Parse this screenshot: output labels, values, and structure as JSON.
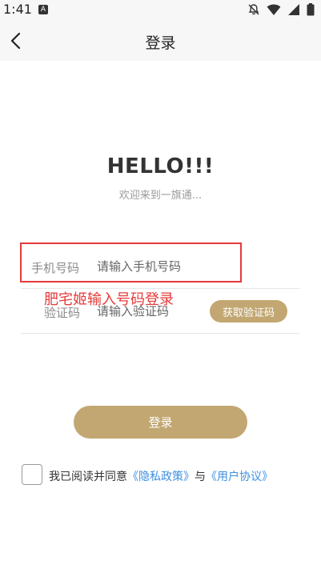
{
  "status_bar": {
    "time": "1:41",
    "notification_letter": "A"
  },
  "nav": {
    "title": "登录"
  },
  "greeting": {
    "title": "HELLO!!!",
    "subtitle": "欢迎来到一旗通..."
  },
  "phone_field": {
    "label": "手机号码",
    "placeholder": "请输入手机号码",
    "value": ""
  },
  "code_field": {
    "label": "验证码",
    "placeholder": "请输入验证码",
    "value": ""
  },
  "annotation": {
    "text": "肥宅姬输入号码登录",
    "color": "#e53a3a"
  },
  "buttons": {
    "get_code": "获取验证码",
    "login": "登录"
  },
  "agreement": {
    "prefix": "我已阅读并同意",
    "privacy_link": "《隐私政策》",
    "connector": "与",
    "user_link": "《用户协议》",
    "checked": false
  },
  "colors": {
    "accent": "#c2a772",
    "link": "#3d8fe0",
    "highlight": "#e53a3a"
  }
}
